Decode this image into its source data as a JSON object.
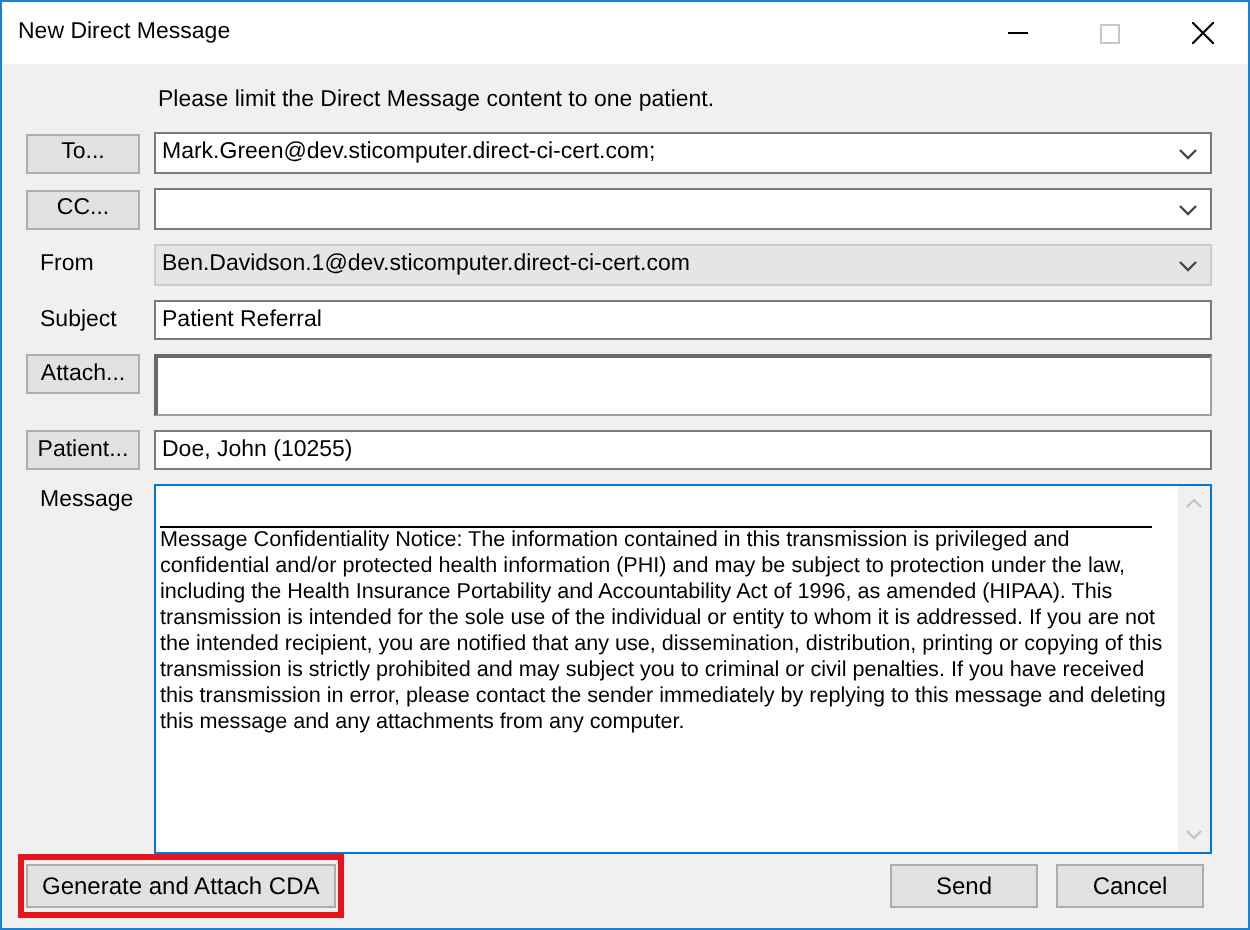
{
  "window": {
    "title": "New Direct Message"
  },
  "notice": "Please limit the Direct Message content to one patient.",
  "fields": [
    {
      "label": {
        "kind": "button",
        "text": "To..."
      },
      "input": {
        "kind": "combo",
        "value": "Mark.Green@dev.sticomputer.direct-ci-cert.com;",
        "disabled": false
      }
    },
    {
      "label": {
        "kind": "button",
        "text": "CC..."
      },
      "input": {
        "kind": "combo",
        "disabled": false
      }
    },
    {
      "label": {
        "kind": "text",
        "text": "From"
      },
      "input": {
        "kind": "combo",
        "value": "Ben.Davidson.1@dev.sticomputer.direct-ci-cert.com",
        "disabled": true
      }
    },
    {
      "label": {
        "kind": "text",
        "text": "Subject"
      },
      "input": {
        "kind": "text",
        "value": "Patient Referral"
      }
    },
    {
      "label": {
        "kind": "button",
        "text": "Attach..."
      },
      "input": {
        "kind": "multiline"
      }
    },
    {
      "label": {
        "kind": "button",
        "text": "Patient..."
      },
      "input": {
        "kind": "text",
        "value": "Doe, John (10255)"
      }
    }
  ],
  "message": {
    "label": "Message",
    "focused": true,
    "value": "Message Confidentiality Notice: The information contained in this transmission is privileged and confidential and/or protected health information (PHI) and may be subject to protection under the law, including the Health Insurance Portability and Accountability Act of 1996, as amended (HIPAA). This transmission is intended for the sole use of the individual or entity to whom it is addressed. If you are not the intended recipient, you are notified that any use, dissemination, distribution, printing or copying of this transmission is strictly prohibited and may subject you to criminal or civil penalties. If you have received this transmission in error, please contact the sender immediately by replying to this message and deleting this message and any attachments from any computer."
  },
  "footer": {
    "left_buttons": [
      {
        "label": "Generate and Attach CDA",
        "highlighted": true
      }
    ],
    "right_buttons": [
      {
        "label": "Send",
        "highlighted": false
      },
      {
        "label": "Cancel",
        "highlighted": false
      }
    ]
  }
}
